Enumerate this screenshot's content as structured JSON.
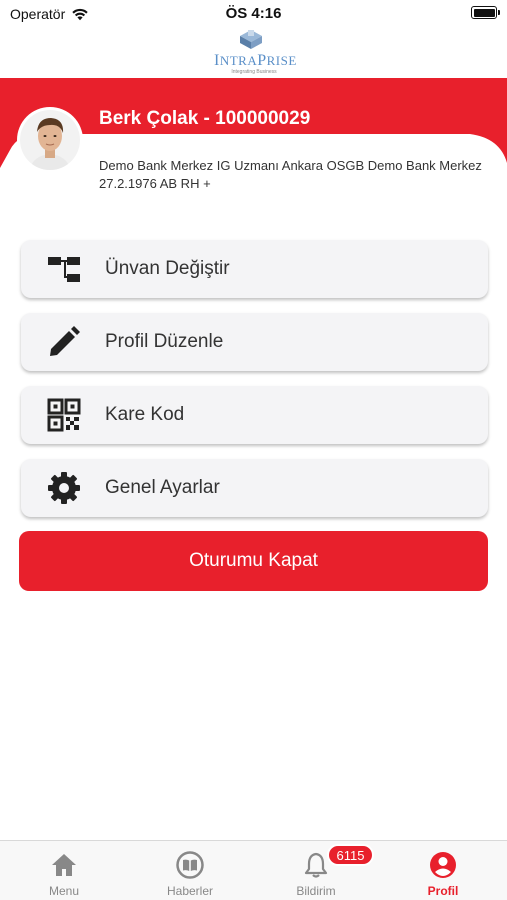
{
  "status_bar": {
    "carrier": "Operatör",
    "time": "ÖS 4:16"
  },
  "logo": {
    "text_first": "I",
    "text_main": "NTRA",
    "text_second": "P",
    "text_rest": "RISE",
    "tagline": "Integrating Business"
  },
  "profile": {
    "name": "Berk Çolak - 100000029",
    "info": "Demo Bank Merkez IG Uzmanı Ankara OSGB Demo Bank Merkez 27.2.1976 AB RH +"
  },
  "menu": {
    "items": [
      {
        "label": "Ünvan Değiştir",
        "icon": "org-chart-icon"
      },
      {
        "label": "Profil Düzenle",
        "icon": "pencil-icon"
      },
      {
        "label": "Kare Kod",
        "icon": "qr-code-icon"
      },
      {
        "label": "Genel Ayarlar",
        "icon": "gear-icon"
      }
    ],
    "logout_label": "Oturumu Kapat"
  },
  "tab_bar": {
    "tabs": [
      {
        "label": "Menu",
        "icon": "home-icon"
      },
      {
        "label": "Haberler",
        "icon": "book-icon"
      },
      {
        "label": "Bildirim",
        "icon": "bell-icon"
      },
      {
        "label": "Profil",
        "icon": "user-icon"
      }
    ],
    "notification_count": "6115",
    "active_tab": "Profil"
  },
  "colors": {
    "accent": "#e8202c",
    "card_background": "#f4f4f6",
    "logo_blue": "#5a8fc8"
  }
}
